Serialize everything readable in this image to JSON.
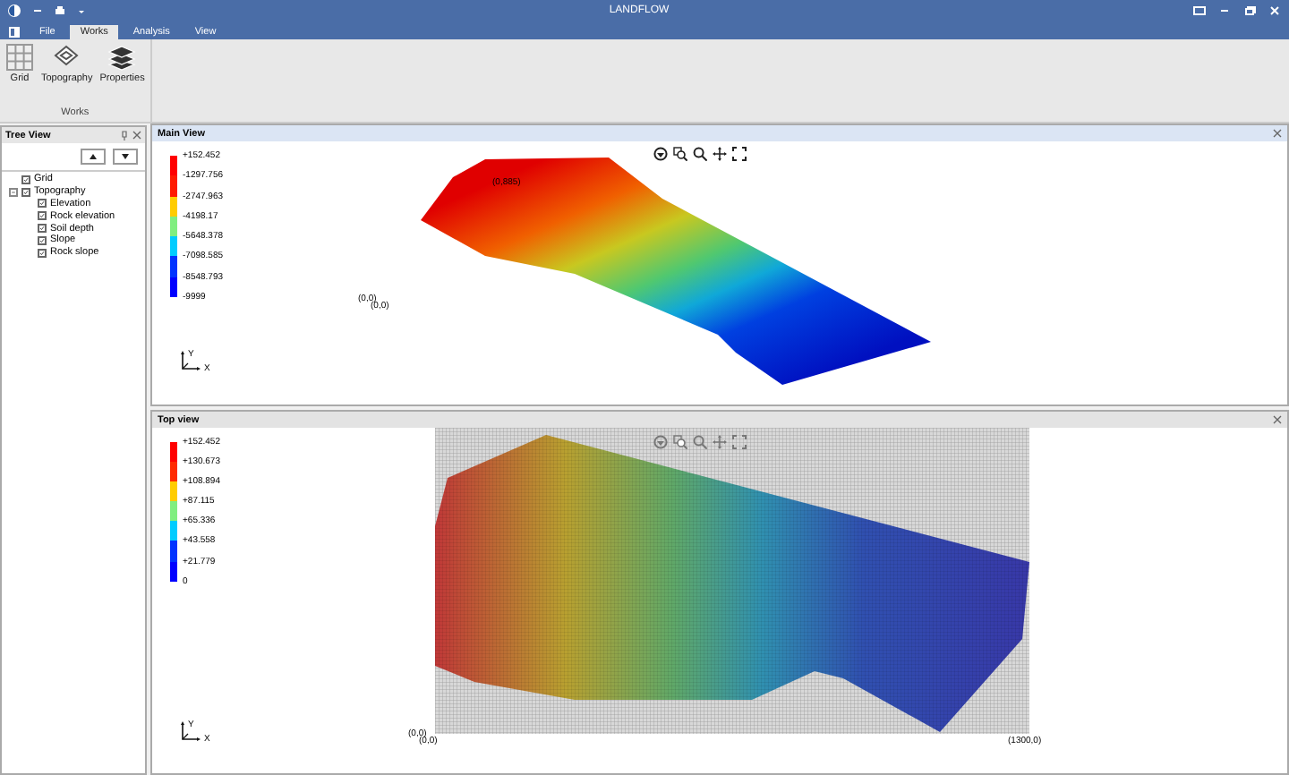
{
  "window": {
    "title": "LANDFLOW"
  },
  "menu_tabs": [
    {
      "label": "File",
      "selected": false
    },
    {
      "label": "Works",
      "selected": true
    },
    {
      "label": "Analysis",
      "selected": false
    },
    {
      "label": "View",
      "selected": false
    }
  ],
  "ribbon": {
    "group_label": "Works",
    "buttons": [
      {
        "label": "Grid",
        "kind": "grid"
      },
      {
        "label": "Topography",
        "kind": "topography"
      },
      {
        "label": "Properties",
        "kind": "properties"
      }
    ]
  },
  "tree_view": {
    "title": "Tree View",
    "items": [
      {
        "label": "Grid",
        "checked": true
      },
      {
        "label": "Topography",
        "checked": true,
        "expanded": true,
        "children": [
          {
            "label": "Elevation",
            "checked": true
          },
          {
            "label": "Rock elevation",
            "checked": true
          },
          {
            "label": "Soil depth",
            "checked": true
          },
          {
            "label": "Slope",
            "checked": true
          },
          {
            "label": "Rock slope",
            "checked": true
          }
        ]
      }
    ]
  },
  "main_view": {
    "title": "Main View",
    "kind": "perspective",
    "legend_labels": [
      "+152.452",
      "-1297.756",
      "-2747.963",
      "-4198.17",
      "-5648.378",
      "-7098.585",
      "-8548.793",
      "-9999"
    ],
    "legend_bands": [
      {
        "color": "#ff0000"
      },
      {
        "color": "#ff1a00"
      },
      {
        "color": "#ffcc00"
      },
      {
        "color": "#80ee80"
      },
      {
        "color": "#00ccff"
      },
      {
        "color": "#0033ff"
      },
      {
        "color": "#0000ff"
      }
    ],
    "point_labels": [
      "(0,885)",
      "(0,0)",
      "(0,0)"
    ],
    "axis_labels": [
      "Y",
      "X"
    ]
  },
  "top_view": {
    "title": "Top view",
    "kind": "plan",
    "legend_labels": [
      "+152.452",
      "+130.673",
      "+108.894",
      "+87.115",
      "+65.336",
      "+43.558",
      "+21.779",
      "0"
    ],
    "legend_bands": [
      {
        "color": "#ff0000"
      },
      {
        "color": "#ff2a00"
      },
      {
        "color": "#ffcc00"
      },
      {
        "color": "#80ee80"
      },
      {
        "color": "#00ccff"
      },
      {
        "color": "#0033ff"
      },
      {
        "color": "#0000ff"
      }
    ],
    "point_labels": [
      "(0,0)",
      "(0,0)",
      "(1300,0)"
    ],
    "axis_labels": [
      "Y",
      "X"
    ]
  }
}
